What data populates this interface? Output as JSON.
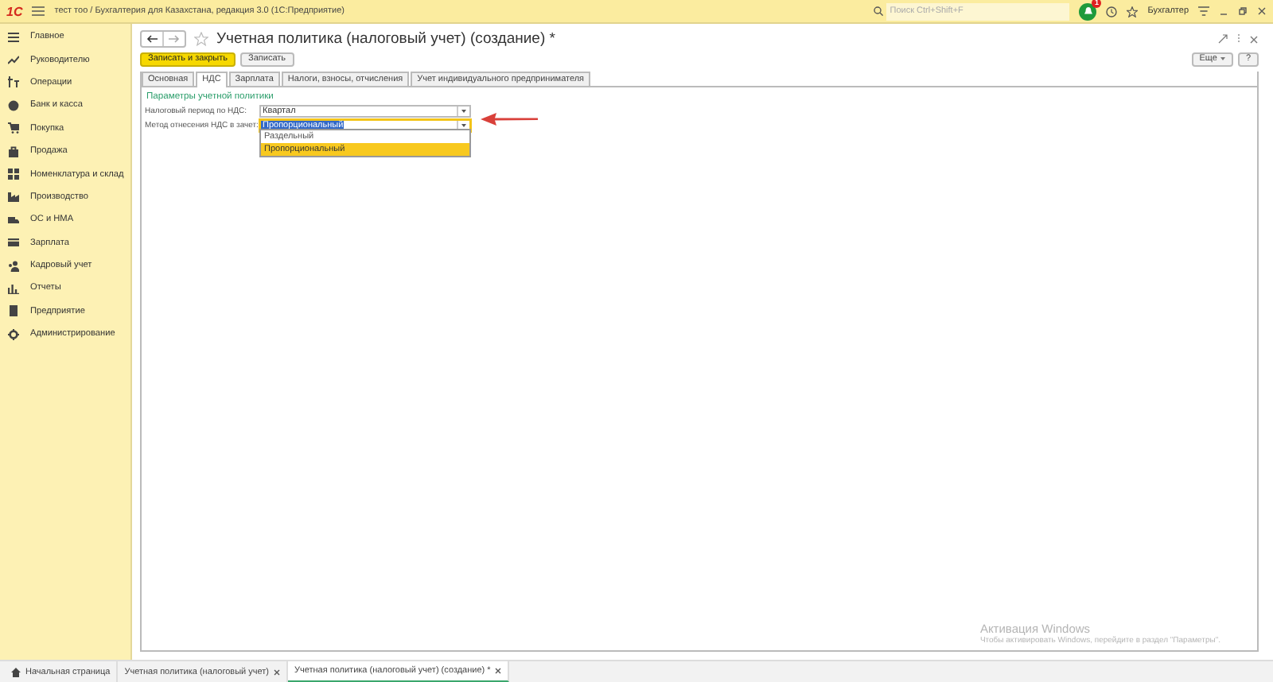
{
  "app_bar": {
    "logo": "1С",
    "title": "тест тоо / Бухгалтерия для Казахстана, редакция 3.0 (1С:Предприятие)",
    "search": {
      "placeholder": "Поиск Ctrl+Shift+F"
    },
    "notification_count": "1",
    "user": "Бухгалтер"
  },
  "sidebar": {
    "items": [
      {
        "label": "Главное"
      },
      {
        "label": "Руководителю"
      },
      {
        "label": "Операции"
      },
      {
        "label": "Банк и касса"
      },
      {
        "label": "Покупка"
      },
      {
        "label": "Продажа"
      },
      {
        "label": "Номенклатура и склад"
      },
      {
        "label": "Производство"
      },
      {
        "label": "ОС и НМА"
      },
      {
        "label": "Зарплата"
      },
      {
        "label": "Кадровый учет"
      },
      {
        "label": "Отчеты"
      },
      {
        "label": "Предприятие"
      },
      {
        "label": "Администрирование"
      }
    ]
  },
  "form": {
    "title": "Учетная политика (налоговый учет) (создание) *",
    "buttons": [
      {
        "label": "Записать и закрыть",
        "kind": "primary"
      },
      {
        "label": "Записать",
        "kind": "default"
      }
    ],
    "more": "Еще",
    "help": "?",
    "tabs": [
      {
        "label": "Основная",
        "selected": false
      },
      {
        "label": "НДС",
        "selected": true
      },
      {
        "label": "Зарплата",
        "selected": false
      },
      {
        "label": "Налоги, взносы, отчисления",
        "selected": false
      },
      {
        "label": "Учет индивидуального предпринимателя",
        "selected": false
      }
    ],
    "group_title": "Параметры учетной политики",
    "fields": [
      {
        "label": "Налоговый период по НДС:",
        "value": "Квартал",
        "focused": false
      },
      {
        "label": "Метод отнесения НДС в зачет:",
        "value": "Пропорциональный",
        "focused": true
      }
    ],
    "dropdown": {
      "options": [
        {
          "label": "Раздельный",
          "selected": false
        },
        {
          "label": "Пропорциональный",
          "selected": true
        }
      ]
    }
  },
  "windows_activation": {
    "title": "Активация Windows",
    "text": "Чтобы активировать Windows, перейдите в раздел \"Параметры\"."
  },
  "open_tabs": [
    {
      "label": "Начальная страница",
      "kind": "home",
      "selected": false
    },
    {
      "label": "Учетная политика (налоговый учет)",
      "kind": "document",
      "selected": false
    },
    {
      "label": "Учетная политика (налоговый учет) (создание) *",
      "kind": "document",
      "selected": true
    }
  ]
}
